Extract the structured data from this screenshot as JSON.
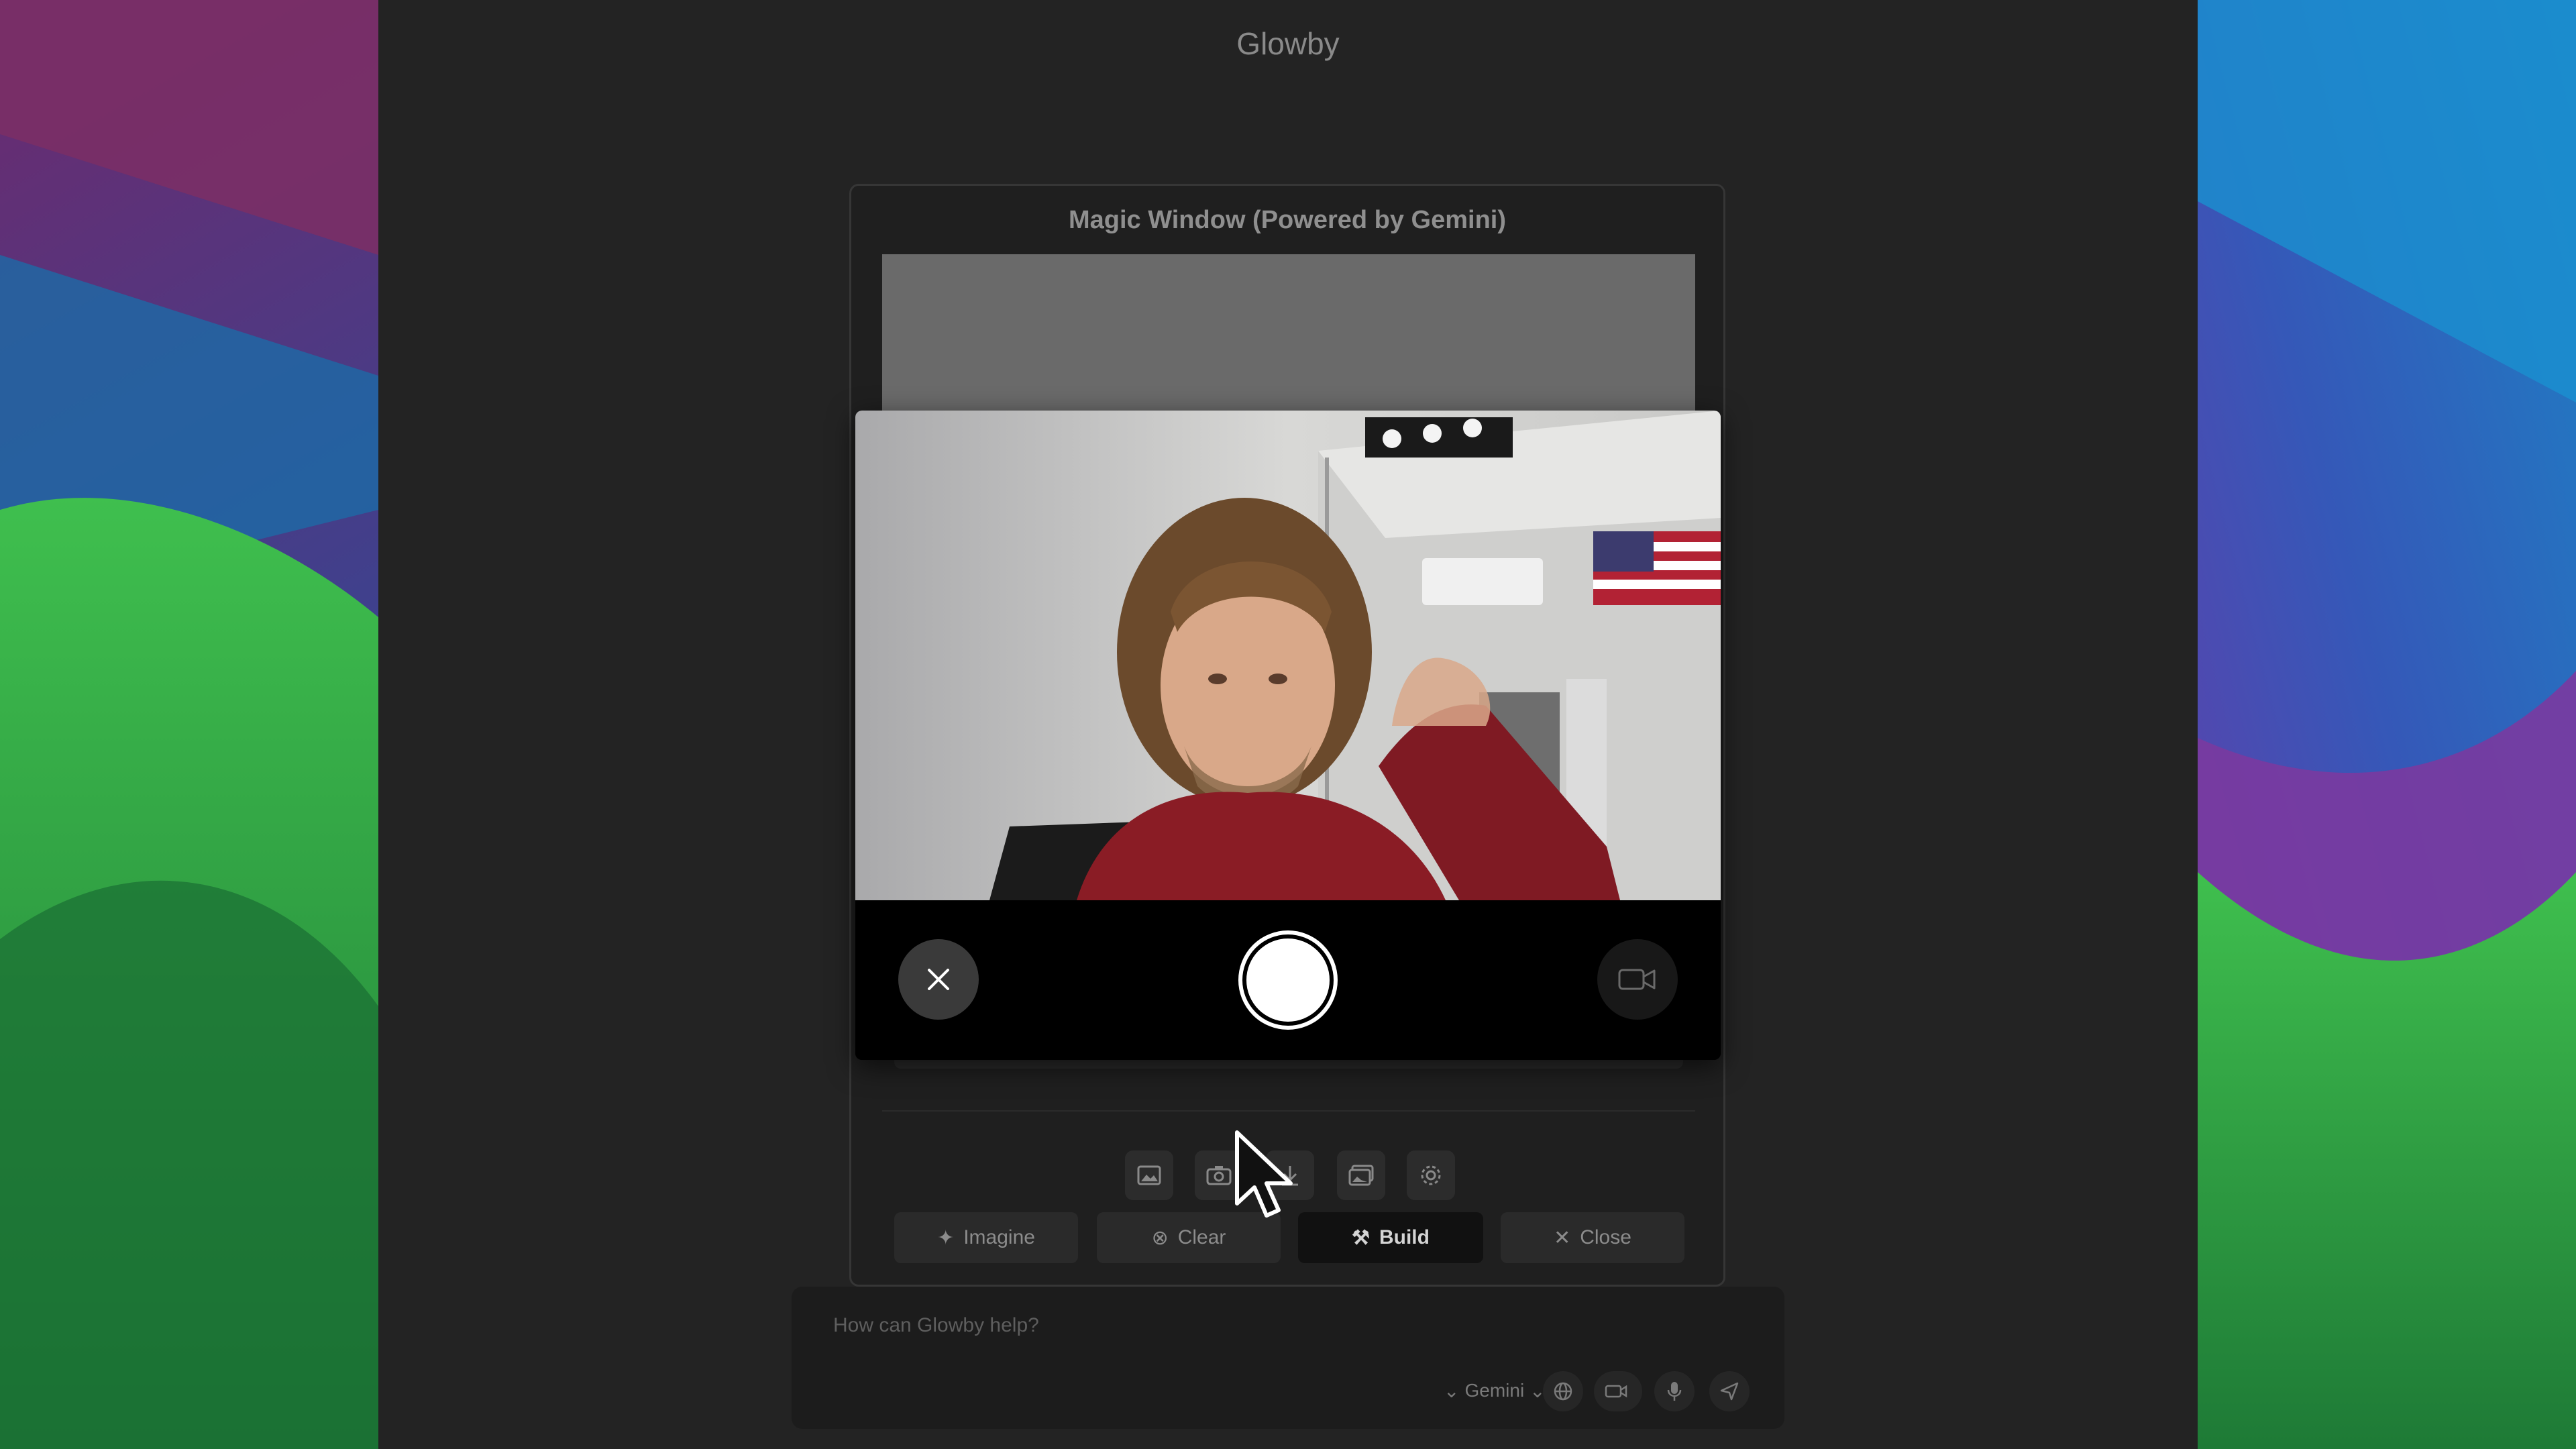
{
  "app": {
    "title": "Glowby"
  },
  "magic_window": {
    "title": "Magic Window (Powered by Gemini)",
    "toolbar": [
      {
        "icon": "image-icon"
      },
      {
        "icon": "camera-icon"
      },
      {
        "icon": "download-icon"
      },
      {
        "icon": "gallery-icon"
      },
      {
        "icon": "gear-icon"
      }
    ],
    "actions": {
      "imagine": "Imagine",
      "clear": "Clear",
      "build": "Build",
      "close": "Close"
    }
  },
  "camera": {
    "close_icon": "close-icon",
    "shutter": "shutter-button",
    "switch_icon": "video-camera-icon"
  },
  "chat": {
    "placeholder": "How can Glowby help?",
    "model": "Gemini"
  },
  "colors": {
    "app_bg": "#232323",
    "panel_bg": "#1f1f1f",
    "primary_button": "#111111"
  }
}
